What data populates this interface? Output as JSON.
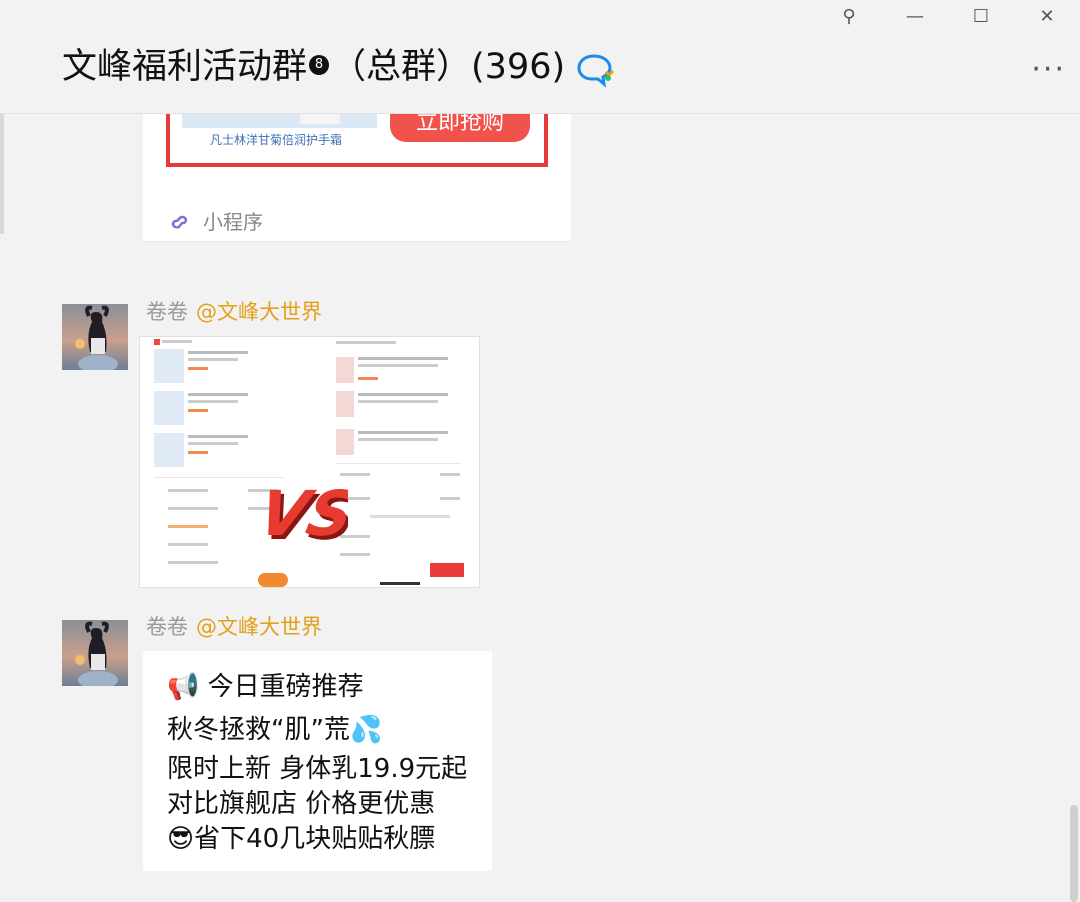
{
  "window": {
    "controls": [
      {
        "name": "pin-icon",
        "glyph": "⚲"
      },
      {
        "name": "minimize-icon",
        "glyph": "—"
      },
      {
        "name": "maximize-icon",
        "glyph": "☐"
      },
      {
        "name": "close-icon",
        "glyph": "✕"
      }
    ]
  },
  "header": {
    "title_main": "文峰福利活动群",
    "badge": "8",
    "title_rest": "（总群）(396)",
    "more_label": "···"
  },
  "mini_card": {
    "promo_caption": "凡士林洋甘菊倍润护手霜",
    "promo_button": "立即抢购",
    "label": "小程序"
  },
  "messages": [
    {
      "nick": "卷卷",
      "mention": "@文峰大世界",
      "type": "image",
      "image_text": "VS"
    },
    {
      "nick": "卷卷",
      "mention": "@文峰大世界",
      "type": "text",
      "lines": [
        "📢 今日重磅推荐",
        "秋冬拯救“肌”荒💦",
        "限时上新 身体乳19.9元起",
        "对比旗舰店 价格更优惠",
        "😎省下40几块贴贴秋膘"
      ]
    }
  ],
  "colors": {
    "promo_red": "#e63b3b",
    "mention_orange": "#e4a01a",
    "mini_icon": "#7a6fd6"
  }
}
